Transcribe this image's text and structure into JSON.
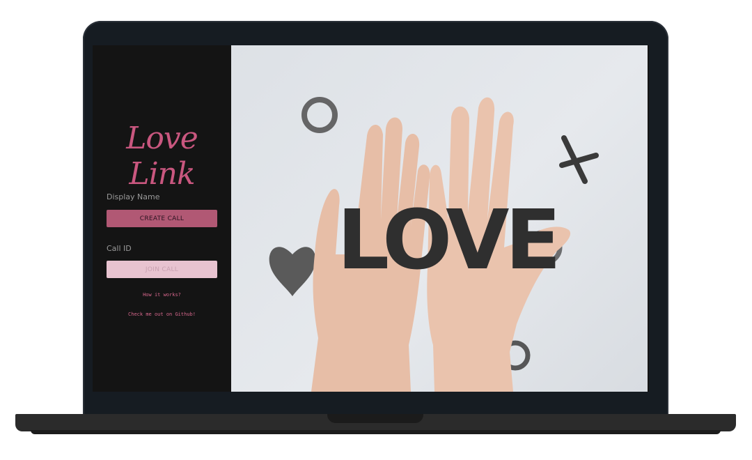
{
  "app": {
    "brand_title": "Love Link"
  },
  "form": {
    "display_name_label": "Display Name",
    "create_call_label": "CREATE CALL",
    "call_id_label": "Call ID",
    "join_call_label": "JOIN CALL"
  },
  "links": {
    "how_it_works": "How it works?",
    "github": "Check me out on Github!"
  },
  "hero": {
    "sign_text": "LOVE"
  },
  "colors": {
    "accent": "#c9577f",
    "create_button": "#b15874",
    "join_button": "#e8c3d0",
    "sidebar_bg": "#141414",
    "link": "#d5668b"
  }
}
